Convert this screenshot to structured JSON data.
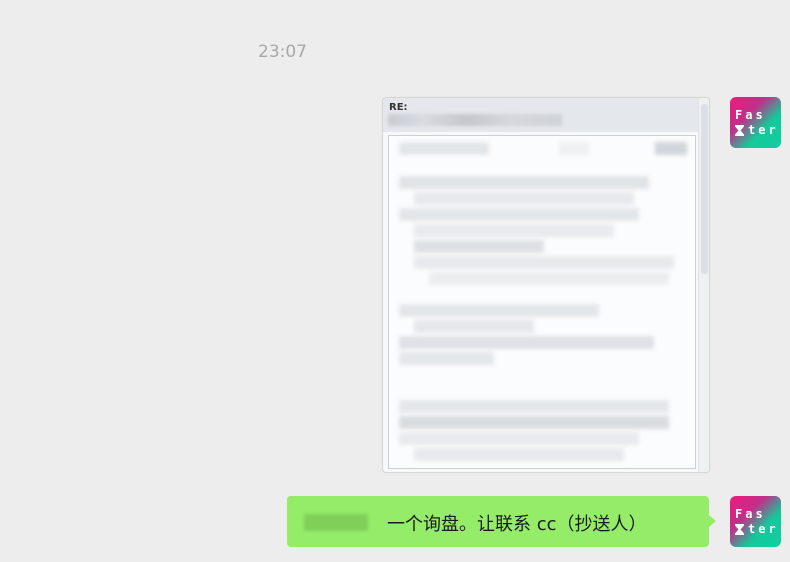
{
  "chat": {
    "timestamp": "23:07",
    "messages": [
      {
        "type": "image",
        "sender": "self",
        "preview_header": "RE:",
        "content_obscured": true
      },
      {
        "type": "text",
        "sender": "self",
        "redacted_prefix": true,
        "text": "一个询盘。让联系 cc（抄送人）"
      }
    ],
    "avatar": {
      "line1": "Fas",
      "line2": "ter",
      "icon": "hourglass-icon",
      "colors": [
        "#f0197a",
        "#15c89a"
      ]
    },
    "bubble_color": "#95ec69",
    "background_color": "#ededed"
  }
}
